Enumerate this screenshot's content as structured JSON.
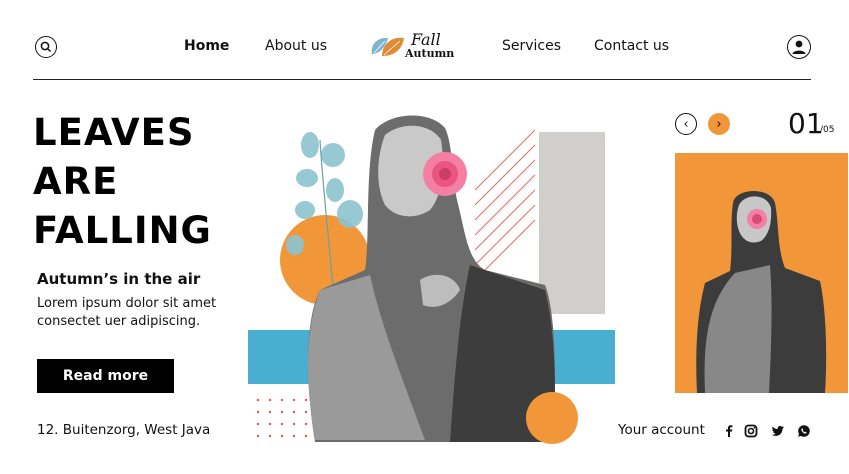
{
  "header": {
    "nav": [
      "Home",
      "About us",
      "Services",
      "Contact us"
    ],
    "logo_line1": "Fall",
    "logo_line2": "Autumn",
    "icons": {
      "search": "search-icon",
      "profile": "user-icon"
    }
  },
  "hero": {
    "title_lines": [
      "LEAVES",
      "ARE",
      "FALLING"
    ],
    "subheading": "Autumn’s in the air",
    "body_line1": "Lorem ipsum dolor sit amet",
    "body_line2": "consectet uer adipiscing.",
    "button_label": "Read more",
    "address": "12. Buitenzorg, West Java"
  },
  "slider": {
    "current": "01",
    "total": "/05"
  },
  "footer": {
    "account_label": "Your account",
    "socials": [
      "facebook-icon",
      "instagram-icon",
      "twitter-icon",
      "whatsapp-icon"
    ]
  },
  "colors": {
    "orange": "#f2963a",
    "blue": "#4aaed1",
    "gray_panel": "#d0cfcb",
    "black": "#000000"
  }
}
